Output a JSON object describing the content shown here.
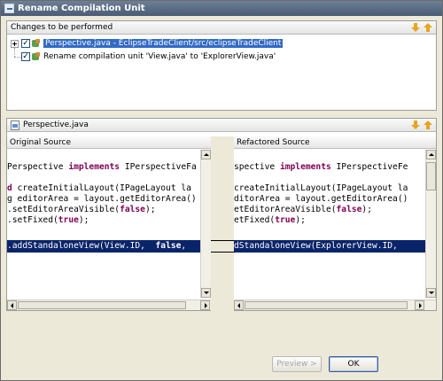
{
  "window": {
    "title": "Rename Compilation Unit"
  },
  "changes_panel": {
    "title": "Changes to be performed",
    "tree": [
      {
        "label": "Perspective.java - EclipseTradeClient/src/eclipseTradeClient",
        "checked": true,
        "selected": true,
        "icon": "java-package-icon"
      },
      {
        "label": "Rename compilation unit 'View.java' to 'ExplorerView.java'",
        "checked": true,
        "selected": false,
        "icon": "java-rename-icon"
      }
    ]
  },
  "compare_panel": {
    "title": "Perspective.java",
    "original_header": "Original Source",
    "refactored_header": "Refactored Source",
    "original_lines": [
      {
        "pre": "Perspective ",
        "kw": "implements",
        "post": " IPerspectiveFa"
      },
      {
        "pre": "",
        "kw": "d",
        "post": " createInitialLayout(IPageLayout la"
      },
      {
        "pre": "g editorArea = layout.getEditorArea()",
        "kw": "",
        "post": ""
      },
      {
        "pre": ".setEditorAreaVisible(",
        "kw": "false",
        "post": ");"
      },
      {
        "pre": ".setFixed(",
        "kw": "true",
        "post": ");"
      },
      {
        "pre": ".addStandaloneView(View.ID,  ",
        "kw": "false",
        "post": ", "
      }
    ],
    "refactored_lines": [
      {
        "pre": "spective ",
        "kw": "implements",
        "post": " IPerspectiveFe"
      },
      {
        "pre": "createInitialLayout(IPageLayout la",
        "kw": "",
        "post": ""
      },
      {
        "pre": "ditorArea = layout.getEditorArea()",
        "kw": "",
        "post": ""
      },
      {
        "pre": "etEditorAreaVisible(",
        "kw": "false",
        "post": ");"
      },
      {
        "pre": "etFixed(",
        "kw": "true",
        "post": ");"
      },
      {
        "pre": "dStandaloneView(ExplorerView.ID, ",
        "kw": "",
        "post": ""
      }
    ]
  },
  "buttons": {
    "preview": "Preview >",
    "ok": "OK"
  },
  "icons": [
    "next-change-icon",
    "previous-change-icon",
    "file-icon",
    "expand-icon"
  ]
}
